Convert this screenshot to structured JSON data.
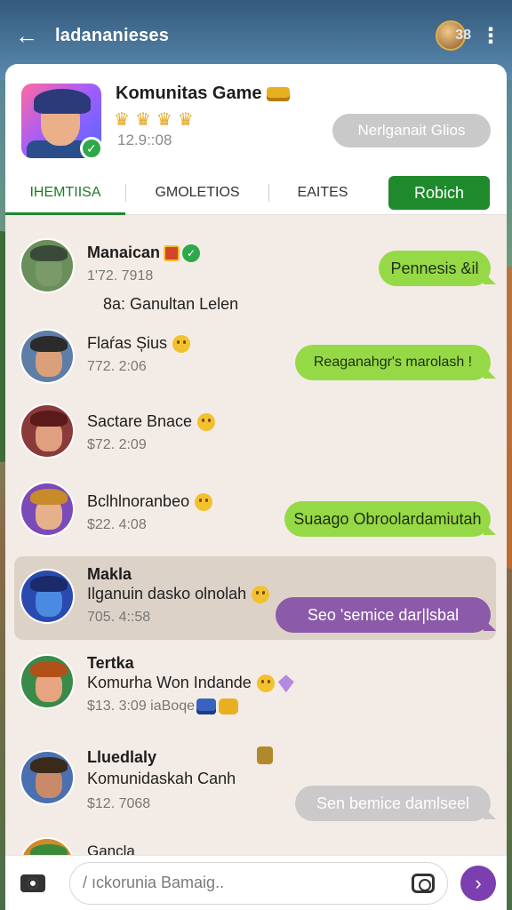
{
  "topbar": {
    "title": "ladananieses",
    "count": "38",
    "icons": [
      "back-arrow-icon",
      "more-vertical-icon"
    ]
  },
  "header": {
    "game_title": "Komunitas Game",
    "crowns": [
      "crown",
      "crown",
      "crown",
      "crown"
    ],
    "time": "12.9::08",
    "pill_label": "Nerlganait  Glios"
  },
  "tabs": [
    {
      "label": "IHEMTIISA"
    },
    {
      "label": "GMOLETIOS"
    },
    {
      "label": "EAITES"
    }
  ],
  "tab_cta": "Robich",
  "chats": [
    {
      "name": "Manaican",
      "time": "1'72. 7918",
      "message": "8a: Ganultan Lelen",
      "bubble": "Pennesis &il",
      "bubble_color": "green"
    },
    {
      "name": "Flaŕas Șius",
      "time": "772. 2:06",
      "bubble": "Reaganahgr's marolash !",
      "bubble_color": "green"
    },
    {
      "name": "Sactare Bnace",
      "time": "$72. 2:09"
    },
    {
      "name": "Bclhlnoranbeo",
      "time": "$22. 4:08",
      "bubble": "Suaago Obroolardamiutah",
      "bubble_color": "green"
    },
    {
      "name": "Makla",
      "message": "Ilganuin dasko olnolah",
      "time": "705. 4::58",
      "bubble": "Seo 'semice dar|lsbal",
      "bubble_color": "purple"
    },
    {
      "name": "Tertka",
      "message": "Komurha Won Indande",
      "time": "$13. 3:09 iaBoqe"
    },
    {
      "name": "Lluedlaly",
      "message": "Komunidaskah Canh",
      "time": "$12. 7068",
      "bubble": "Sen bemice damlseel",
      "bubble_color": "gray"
    },
    {
      "name": "Gancla"
    }
  ],
  "composer": {
    "placeholder": "/ ıckorunia Bamaig.."
  },
  "colors": {
    "accent_green": "#1f8a2b",
    "bubble_green": "#96d947",
    "bubble_purple": "#8b5aa8",
    "send_purple": "#7b3fb0"
  }
}
